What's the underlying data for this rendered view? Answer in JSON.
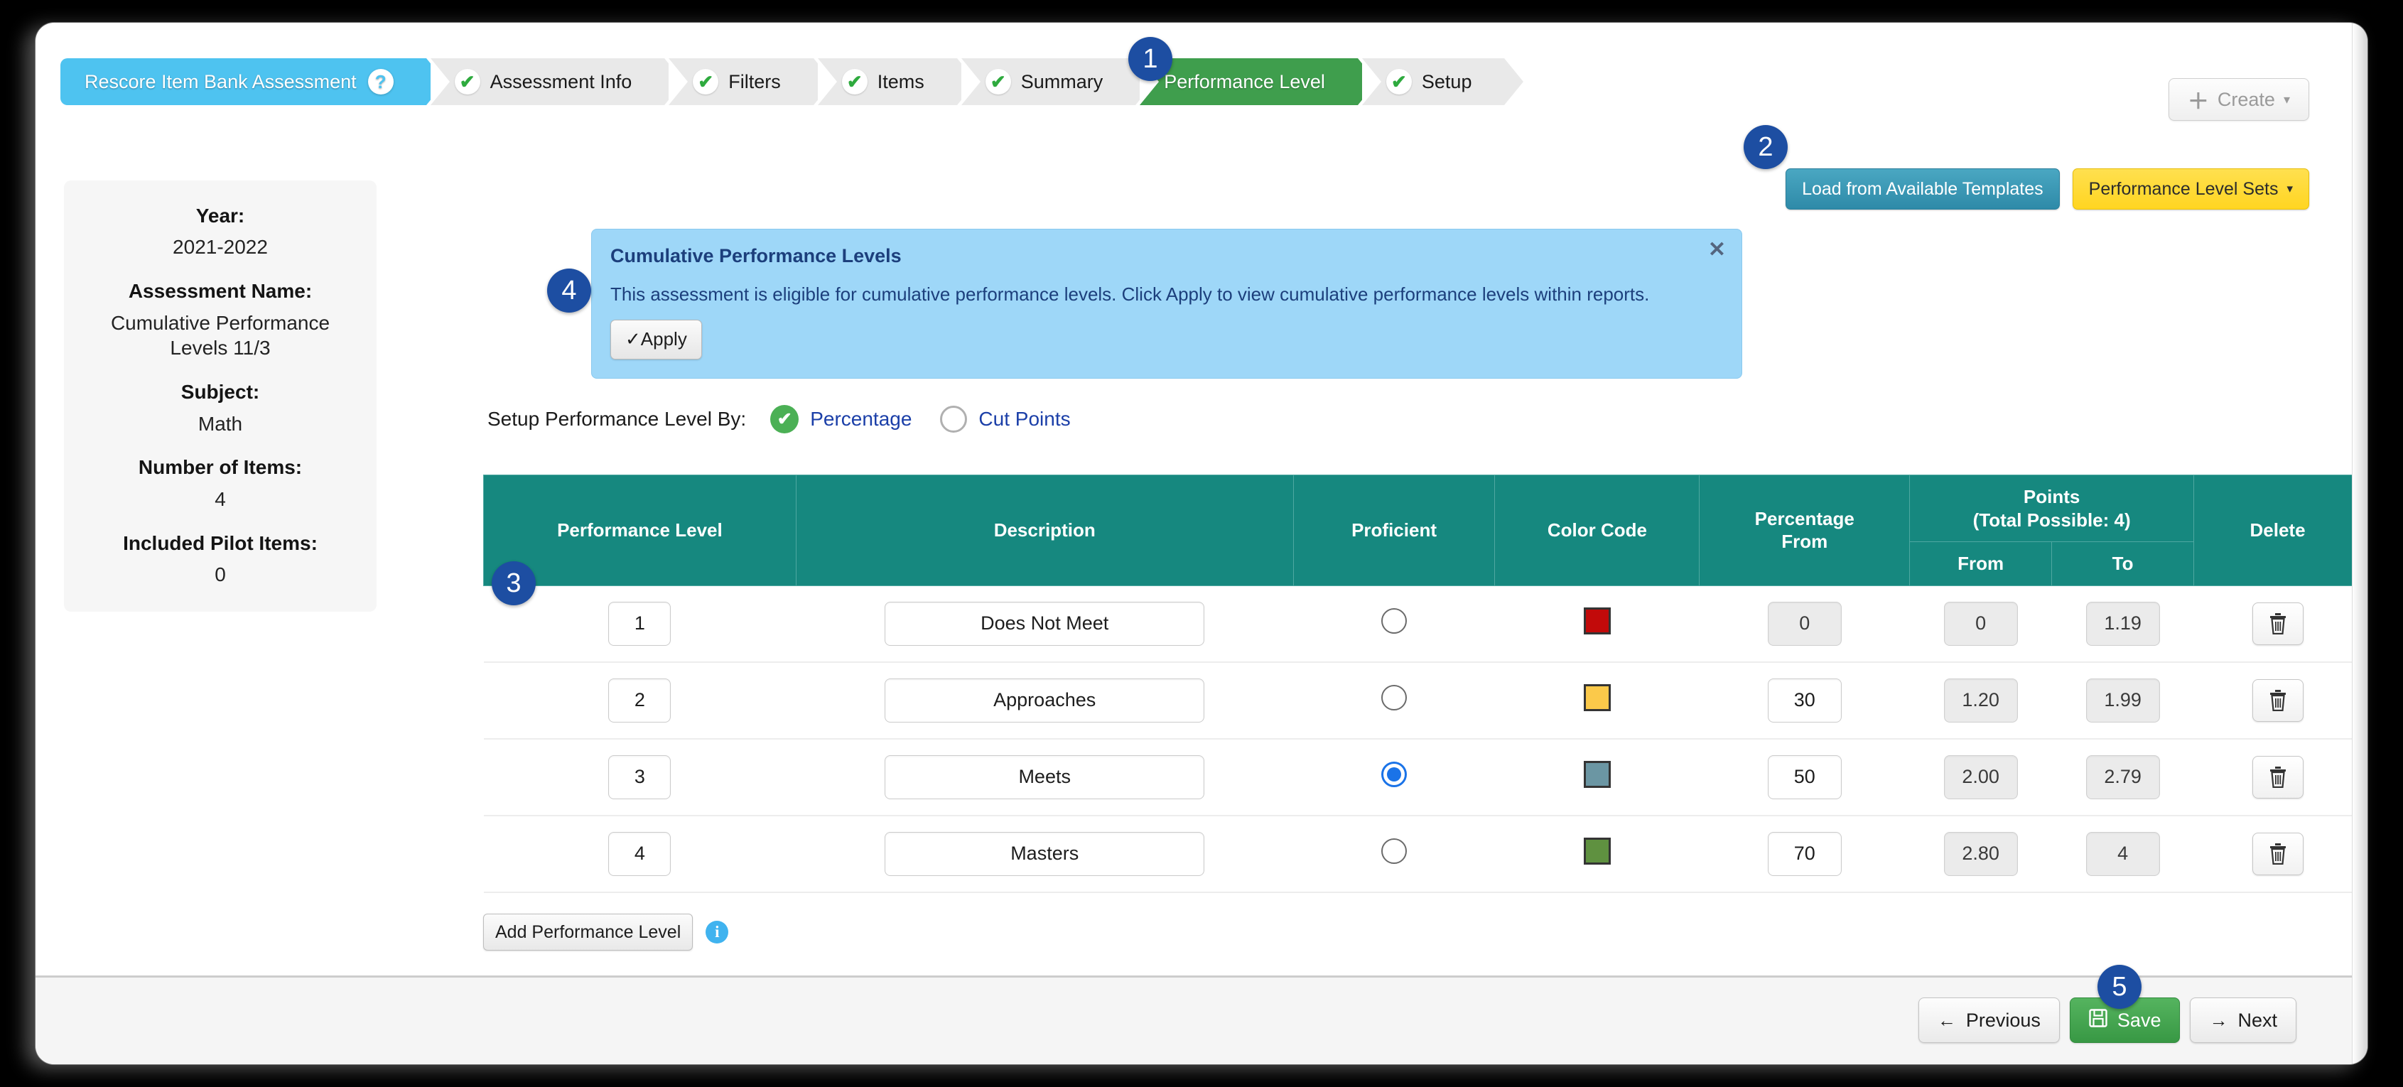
{
  "window": {
    "steps": [
      {
        "label": "Rescore Item Bank Assessment",
        "state": "first",
        "help_icon": "question-mark-icon",
        "help_glyph": "?"
      },
      {
        "label": "Assessment Info",
        "state": "done",
        "check": "✔"
      },
      {
        "label": "Filters",
        "state": "done",
        "check": "✔"
      },
      {
        "label": "Items",
        "state": "done",
        "check": "✔"
      },
      {
        "label": "Summary",
        "state": "done",
        "check": "✔"
      },
      {
        "label": "Performance Level",
        "state": "active"
      },
      {
        "label": "Setup",
        "state": "done",
        "check": "✔"
      }
    ],
    "create_button": {
      "label": "Create",
      "plus": "＋",
      "caret": "▾"
    }
  },
  "toolbar": {
    "load_templates_label": "Load from Available Templates",
    "performance_level_sets_label": "Performance Level Sets",
    "caret": "▾"
  },
  "info_panel": {
    "fields": [
      {
        "label": "Year:",
        "value": "2021-2022"
      },
      {
        "label": "Assessment Name:",
        "value": "Cumulative Performance Levels 11/3"
      },
      {
        "label": "Subject:",
        "value": "Math"
      },
      {
        "label": "Number of Items:",
        "value": "4"
      },
      {
        "label": "Included Pilot Items:",
        "value": "0"
      }
    ]
  },
  "alert": {
    "title": "Cumulative Performance Levels",
    "text": "This assessment is eligible for cumulative performance levels. Click Apply to view cumulative performance levels within reports.",
    "apply_label": "✓Apply",
    "close_glyph": "✕",
    "background_color": "#9ed7f8",
    "text_color": "#1c3f7c"
  },
  "setup_by": {
    "label": "Setup Performance Level By:",
    "options": [
      {
        "label": "Percentage",
        "selected": true,
        "check": "✔"
      },
      {
        "label": "Cut Points",
        "selected": false
      }
    ]
  },
  "table": {
    "headers": {
      "performance_level": "Performance Level",
      "description": "Description",
      "proficient": "Proficient",
      "color_code": "Color Code",
      "percentage_from": "Percentage\nFrom",
      "percentage_from_line1": "Percentage",
      "percentage_from_line2": "From",
      "points_group_line1": "Points",
      "points_group_line2": "(Total Possible: 4)",
      "points_from": "From",
      "points_to": "To",
      "delete": "Delete"
    },
    "header_color": "#16887f",
    "rows": [
      {
        "level": "1",
        "description": "Does Not Meet",
        "proficient": false,
        "color": "#c20a0a",
        "percentage_from": "0",
        "percentage_from_disabled": true,
        "points_from": "0",
        "points_to": "1.19",
        "delete_icon": "trash-icon"
      },
      {
        "level": "2",
        "description": "Approaches",
        "proficient": false,
        "color": "#fbc94a",
        "percentage_from": "30",
        "percentage_from_disabled": false,
        "points_from": "1.20",
        "points_to": "1.99",
        "delete_icon": "trash-icon"
      },
      {
        "level": "3",
        "description": "Meets",
        "proficient": true,
        "color": "#6b96a3",
        "percentage_from": "50",
        "percentage_from_disabled": false,
        "points_from": "2.00",
        "points_to": "2.79",
        "delete_icon": "trash-icon"
      },
      {
        "level": "4",
        "description": "Masters",
        "proficient": false,
        "color": "#5f9140",
        "percentage_from": "70",
        "percentage_from_disabled": false,
        "points_from": "2.80",
        "points_to": "4",
        "delete_icon": "trash-icon"
      }
    ],
    "add_label": "Add Performance Level",
    "info_glyph": "i"
  },
  "footer": {
    "previous_label": "Previous",
    "previous_icon": "←",
    "save_label": "Save",
    "save_icon": "💾",
    "next_label": "Next",
    "next_icon": "→"
  },
  "badges": {
    "b1": "1",
    "b2": "2",
    "b3": "3",
    "b4": "4",
    "b5": "5"
  }
}
